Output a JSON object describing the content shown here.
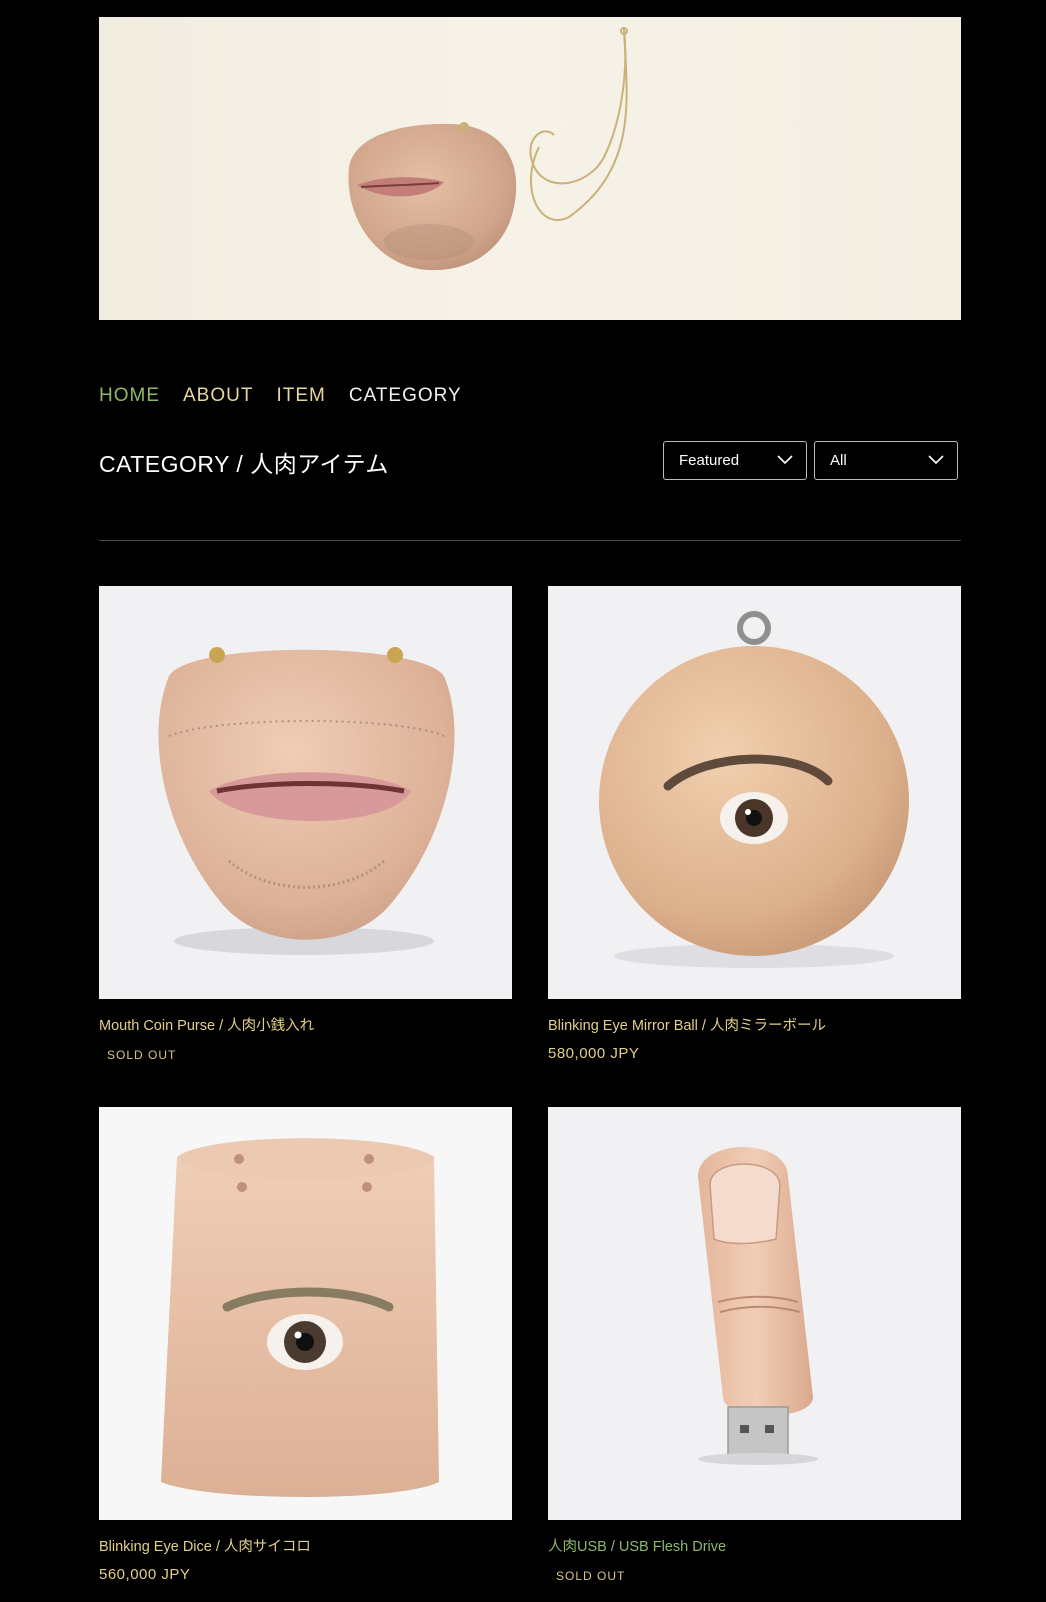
{
  "hero": {
    "image": "mouth-necklace-photo"
  },
  "nav": {
    "home": "HOME",
    "about": "ABOUT",
    "item": "ITEM",
    "category": "CATEGORY"
  },
  "page_title": "CATEGORY / 人肉アイテム",
  "sort": {
    "selected": "Featured"
  },
  "filter": {
    "selected": "All"
  },
  "products": [
    {
      "name": "Mouth Coin Purse / 人肉小銭入れ",
      "status": "SOLD OUT",
      "image": "mouth-coin-purse"
    },
    {
      "name": "Blinking Eye Mirror Ball / 人肉ミラーボール",
      "price": "580,000 JPY",
      "image": "eye-mirror-ball"
    },
    {
      "name": "Blinking Eye Dice / 人肉サイコロ",
      "price": "560,000 JPY",
      "image": "eye-dice"
    },
    {
      "name": "人肉USB / USB Flesh Drive",
      "status": "SOLD OUT",
      "image": "finger-usb"
    }
  ],
  "colors": {
    "background": "#000000",
    "nav_active": "#8fb86a",
    "nav_link": "#e6d89a",
    "product_text": "#e2cf88"
  }
}
